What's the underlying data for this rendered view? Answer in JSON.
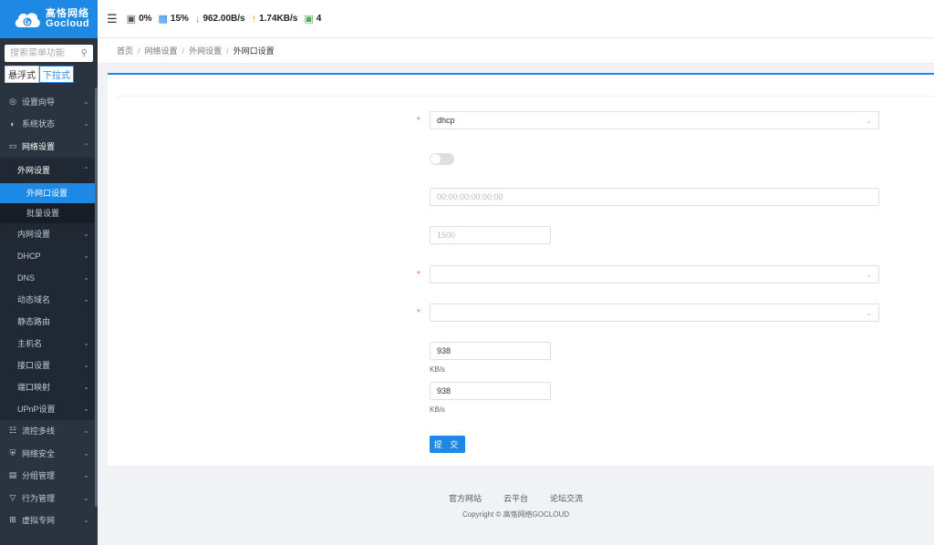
{
  "brand": {
    "cn": "高恪网络",
    "en": "Gocloud"
  },
  "sidebar": {
    "search_placeholder": "搜索菜单功能",
    "mode_float": "悬浮式",
    "mode_dropdown": "下拉式",
    "top_items": [
      {
        "label": "设置向导",
        "icon": "compass-icon"
      },
      {
        "label": "系统状态",
        "icon": "gauge-icon"
      },
      {
        "label": "网络设置",
        "icon": "monitor-icon"
      }
    ],
    "wan_group": "外网设置",
    "wan_sub": [
      "外网口设置",
      "批量设置"
    ],
    "network_sub": [
      "内网设置",
      "DHCP",
      "DNS",
      "动态域名",
      "静态路由",
      "主机名",
      "接口设置",
      "端口映射",
      "UPnP设置"
    ],
    "bottom_items": [
      {
        "label": "流控多线",
        "icon": "branch-icon"
      },
      {
        "label": "网络安全",
        "icon": "shield-icon"
      },
      {
        "label": "分组管理",
        "icon": "list-icon"
      },
      {
        "label": "行为管理",
        "icon": "filter-icon"
      },
      {
        "label": "虚拟专网",
        "icon": "network-icon"
      }
    ]
  },
  "topbar": {
    "cpu": "0%",
    "memory": "15%",
    "download": "962.00B/s",
    "upload": "1.74KB/s",
    "devices": "4"
  },
  "breadcrumb": [
    "首页",
    "网络设置",
    "外网设置",
    "外网口设置"
  ],
  "form": {
    "mode_value": "dhcp",
    "mac_placeholder": "00:00:00:00:00:00",
    "mtu_placeholder": "1500",
    "upload_value": "938",
    "download_value": "938",
    "unit": "KB/s",
    "submit": "提 交"
  },
  "footer": {
    "links": [
      "官方网站",
      "云平台",
      "论坛交流"
    ],
    "copyright": "Copyright © 高恪网络GOCLOUD"
  },
  "colors": {
    "accent": "#1e88e5",
    "sidebar_bg": "#2a3441",
    "required": "#f56c6c"
  }
}
